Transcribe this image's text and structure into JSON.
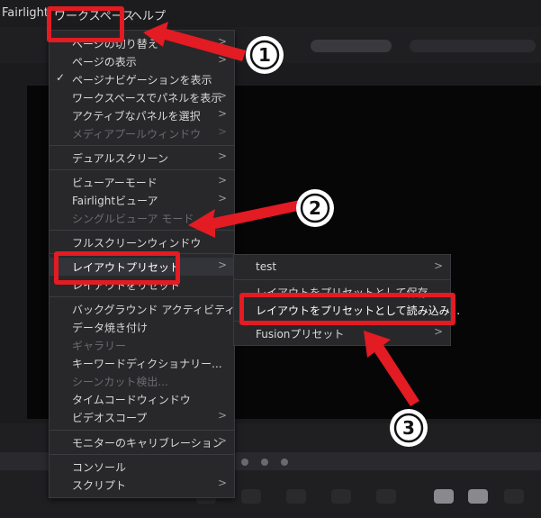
{
  "menubar": {
    "app": "Fairlight",
    "workspace": "ワークスペース",
    "help": "ヘルプ"
  },
  "menu": {
    "items": [
      {
        "label": "ページの切り替え",
        "arrow": true
      },
      {
        "label": "ページの表示",
        "arrow": true
      },
      {
        "label": "ページナビゲーションを表示",
        "check": true
      },
      {
        "label": "ワークスペースでパネルを表示",
        "arrow": true
      },
      {
        "label": "アクティブなパネルを選択",
        "arrow": true
      },
      {
        "label": "メディアプールウィンドウ",
        "arrow": true,
        "disabled": true
      },
      {
        "label": "デュアルスクリーン",
        "arrow": true
      },
      {
        "label": "ビューアーモード",
        "arrow": true
      },
      {
        "label": "Fairlightビューア",
        "arrow": true
      },
      {
        "label": "シングルビューア モード",
        "disabled": true
      },
      {
        "label": "フルスクリーンウィンドウ"
      },
      {
        "label": "レイアウトプリセット",
        "arrow": true
      },
      {
        "label": "レイアウトをリセット"
      },
      {
        "label": "バックグラウンド アクティビティ"
      },
      {
        "label": "データ焼き付け"
      },
      {
        "label": "ギャラリー",
        "disabled": true
      },
      {
        "label": "キーワードディクショナリー..."
      },
      {
        "label": "シーンカット検出...",
        "disabled": true
      },
      {
        "label": "タイムコードウィンドウ"
      },
      {
        "label": "ビデオスコープ",
        "arrow": true
      },
      {
        "label": "モニターのキャリブレーション",
        "arrow": true
      },
      {
        "label": "コンソール"
      },
      {
        "label": "スクリプト",
        "arrow": true
      }
    ]
  },
  "submenu": {
    "items": [
      {
        "label": "test",
        "arrow": true
      },
      {
        "label": "レイアウトをプリセットとして保存..."
      },
      {
        "label": "レイアウトをプリセットとして読み込み..."
      },
      {
        "label": "Fusionプリセット",
        "arrow": true
      }
    ]
  },
  "annotations": {
    "n1": "①",
    "n2": "②",
    "n3": "③"
  },
  "colors": {
    "annotation_red": "#e31b23",
    "menu_bg": "#28282b"
  }
}
